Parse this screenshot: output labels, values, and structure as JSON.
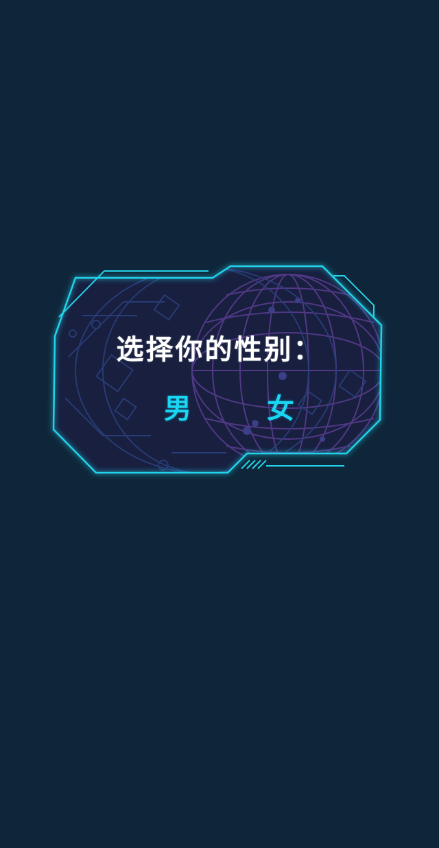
{
  "gender_prompt": {
    "title": "选择你的性别：",
    "options": [
      {
        "label": "男"
      },
      {
        "label": "女"
      }
    ]
  },
  "colors": {
    "background": "#0f263a",
    "panel_fill": "#181f3f",
    "frame_stroke": "#23d3ea",
    "option_text": "#19d6f2",
    "title_text": "#ffffff",
    "globe_lines": "#5f3f93"
  }
}
